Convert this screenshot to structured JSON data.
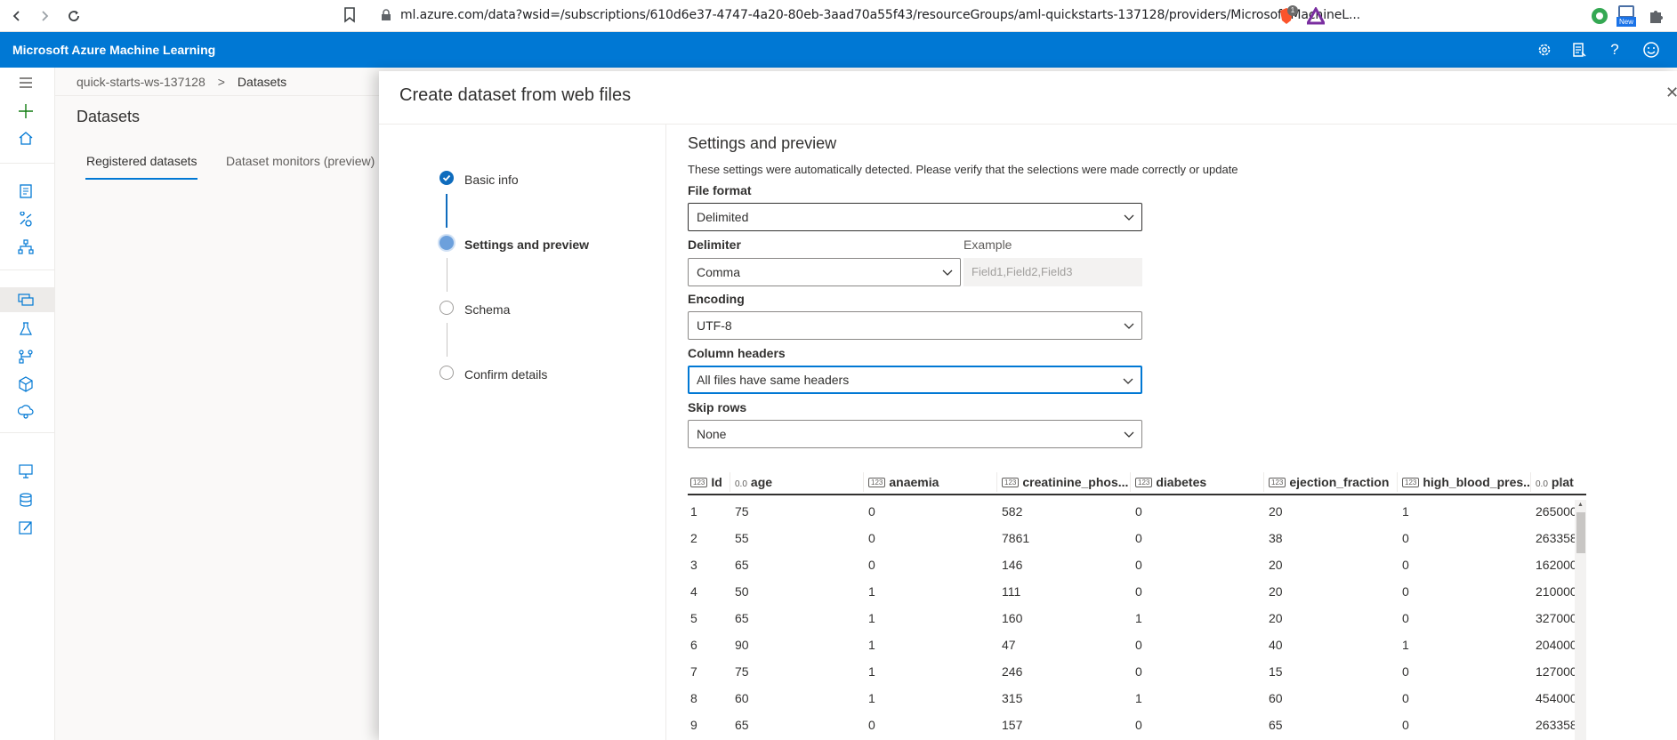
{
  "browser": {
    "url": "ml.azure.com/data?wsid=/subscriptions/610d6e37-4747-4a20-80eb-3aad70a55f43/resourceGroups/aml-quickstarts-137128/providers/Microsoft.MachineL...",
    "brave_badge": "1",
    "ext_new_label": "New"
  },
  "header": {
    "title": "Microsoft Azure Machine Learning"
  },
  "background": {
    "breadcrumb": {
      "workspace": "quick-starts-ws-137128",
      "separator": ">",
      "current": "Datasets"
    },
    "title": "Datasets",
    "tabs": [
      {
        "label": "Registered datasets",
        "active": true
      },
      {
        "label": "Dataset monitors (preview)",
        "active": false
      }
    ]
  },
  "dialog": {
    "title": "Create dataset from web files",
    "close": "✕",
    "steps": [
      {
        "label": "Basic info",
        "state": "done"
      },
      {
        "label": "Settings and preview",
        "state": "current"
      },
      {
        "label": "Schema",
        "state": "pending"
      },
      {
        "label": "Confirm details",
        "state": "pending"
      }
    ],
    "settings": {
      "title": "Settings and preview",
      "description": "These settings were automatically detected. Please verify that the selections were made correctly or update",
      "file_format": {
        "label": "File format",
        "value": "Delimited"
      },
      "delimiter": {
        "label": "Delimiter",
        "value": "Comma"
      },
      "example": {
        "label": "Example",
        "value": "Field1,Field2,Field3"
      },
      "encoding": {
        "label": "Encoding",
        "value": "UTF-8"
      },
      "column_headers": {
        "label": "Column headers",
        "value": "All files have same headers"
      },
      "skip_rows": {
        "label": "Skip rows",
        "value": "None"
      }
    },
    "preview": {
      "columns": [
        {
          "type": "123",
          "name": "Id"
        },
        {
          "type": "0.0",
          "name": "age"
        },
        {
          "type": "123",
          "name": "anaemia"
        },
        {
          "type": "123",
          "name": "creatinine_phos..."
        },
        {
          "type": "123",
          "name": "diabetes"
        },
        {
          "type": "123",
          "name": "ejection_fraction"
        },
        {
          "type": "123",
          "name": "high_blood_pres..."
        },
        {
          "type": "0.0",
          "name": "plat"
        }
      ],
      "rows": [
        [
          "1",
          "75",
          "0",
          "582",
          "0",
          "20",
          "1",
          "265000"
        ],
        [
          "2",
          "55",
          "0",
          "7861",
          "0",
          "38",
          "0",
          "263358"
        ],
        [
          "3",
          "65",
          "0",
          "146",
          "0",
          "20",
          "0",
          "162000"
        ],
        [
          "4",
          "50",
          "1",
          "111",
          "0",
          "20",
          "0",
          "210000"
        ],
        [
          "5",
          "65",
          "1",
          "160",
          "1",
          "20",
          "0",
          "327000"
        ],
        [
          "6",
          "90",
          "1",
          "47",
          "0",
          "40",
          "1",
          "204000"
        ],
        [
          "7",
          "75",
          "1",
          "246",
          "0",
          "15",
          "0",
          "127000"
        ],
        [
          "8",
          "60",
          "1",
          "315",
          "1",
          "60",
          "0",
          "454000"
        ],
        [
          "9",
          "65",
          "0",
          "157",
          "0",
          "65",
          "0",
          "263358"
        ]
      ]
    }
  },
  "colors": {
    "accent": "#0078d4",
    "header_bg": "#0078d4",
    "step_done": "#0f6cbd"
  }
}
